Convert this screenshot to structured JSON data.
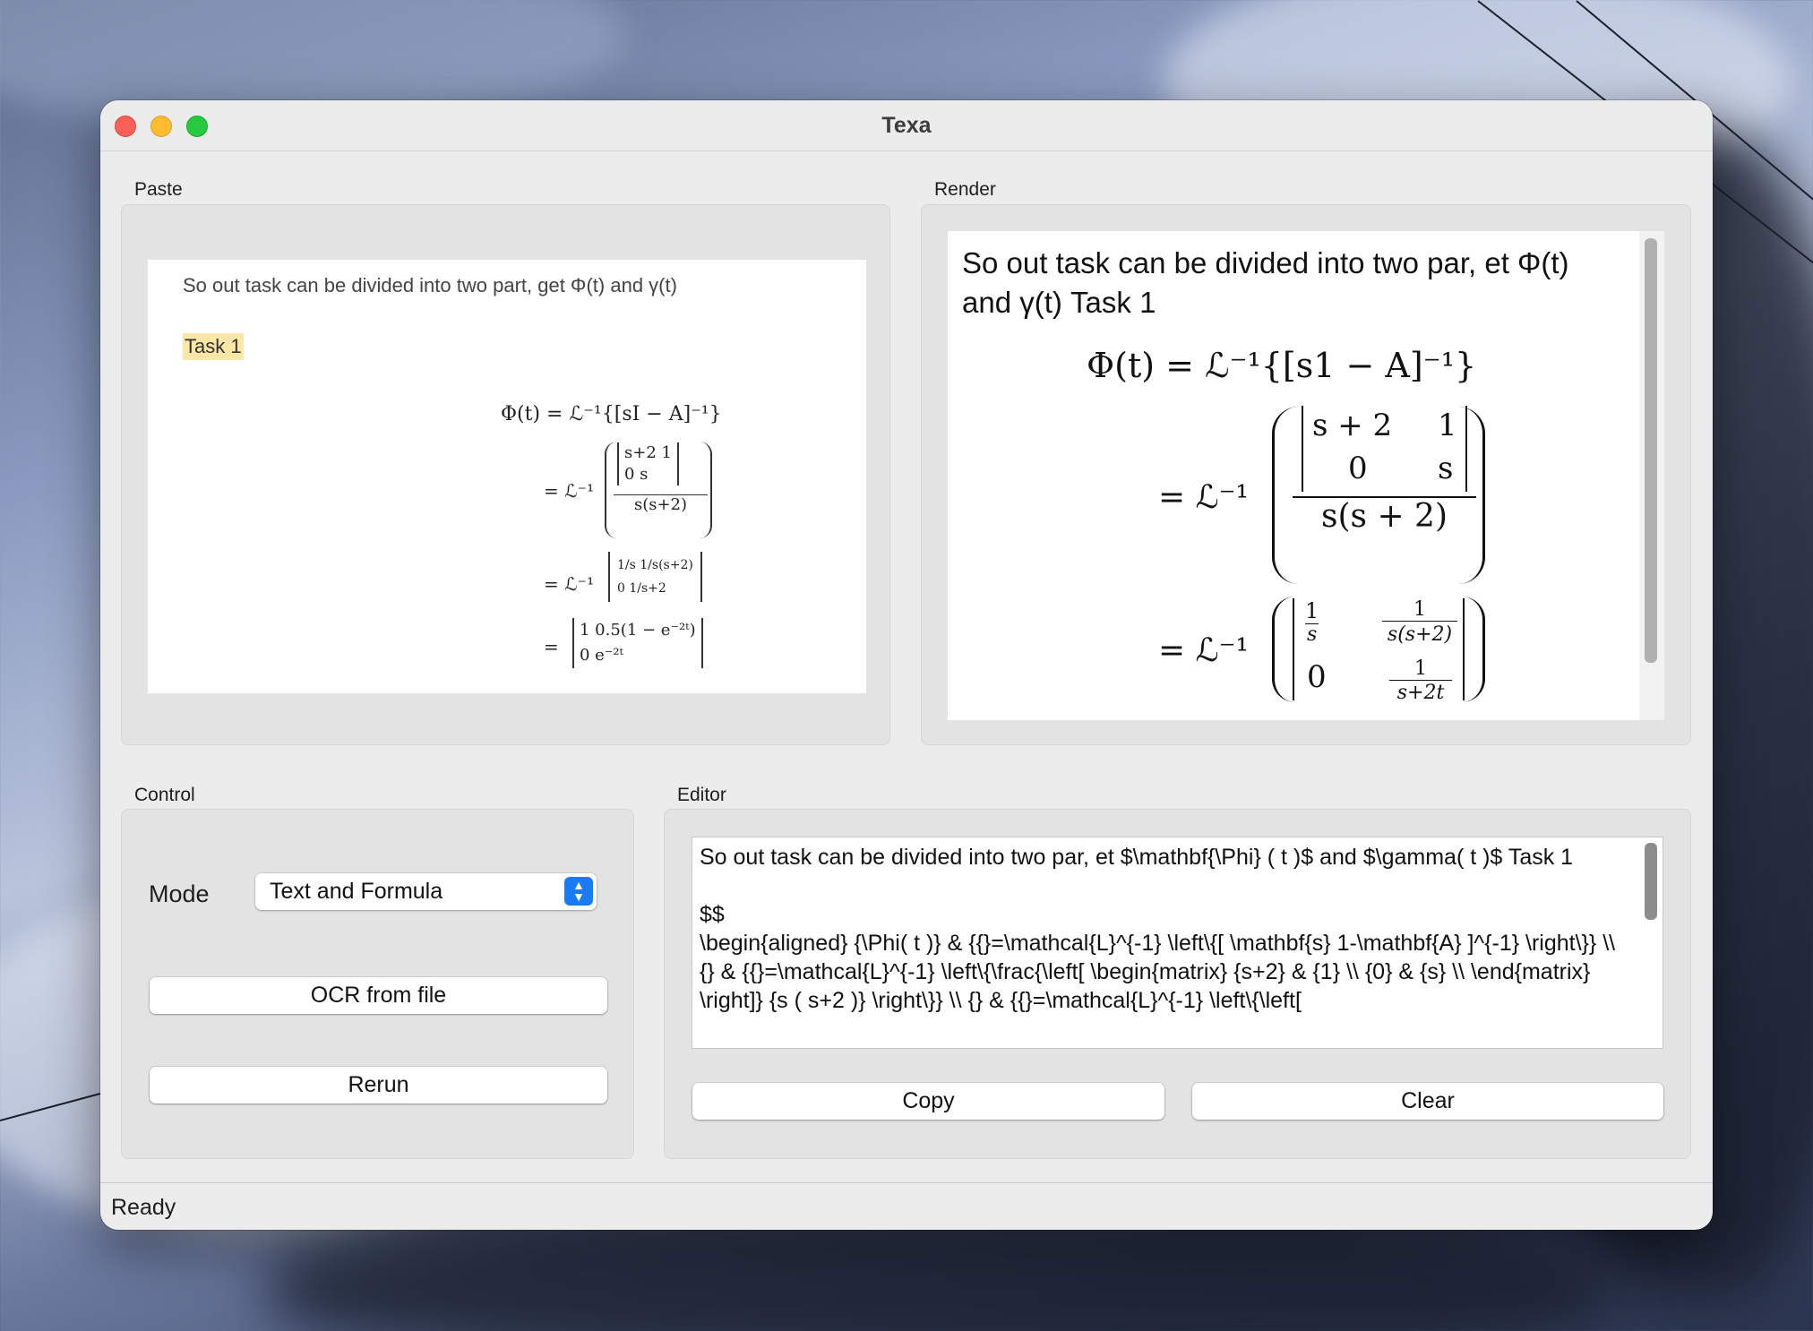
{
  "window": {
    "title": "Texa"
  },
  "paste": {
    "label": "Paste",
    "line1": "So out task can be divided into two part, get Φ(t) and γ(t)",
    "task": "Task 1",
    "eq1": "Φ(t) = ℒ⁻¹{[sI − A]⁻¹}",
    "eq2": "= ℒ⁻¹",
    "m11": "s+2   1",
    "m21": "0      s",
    "den": "s(s+2)",
    "eq3": "= ℒ⁻¹",
    "r3a": "1/s     1/s(s+2)",
    "r3b": "0       1/s+2",
    "eq4": "=",
    "r4a": "1   0.5(1 − e⁻²ᵗ)",
    "r4b": "0        e⁻²ᵗ"
  },
  "render": {
    "label": "Render",
    "text": "So out task can be divided into two par, et Φ(t) and γ(t) Task 1",
    "eq1": "Φ(t) = ℒ⁻¹{[s1 − A]⁻¹}",
    "eq2": "= ℒ⁻¹",
    "m11": "s + 2",
    "m12": "1",
    "m21": "0",
    "m22": "s",
    "den": "s(s + 2)",
    "eq3": "= ℒ⁻¹",
    "r3a": "1",
    "r3a_den": "s",
    "r3b": "1",
    "r3b_den": "s(s+2)",
    "r3c": "0",
    "r3d": "1",
    "r3d_den": "s+2t"
  },
  "control": {
    "label": "Control",
    "mode_label": "Mode",
    "mode_value": "Text and Formula",
    "ocr_button": "OCR from file",
    "rerun_button": "Rerun"
  },
  "editor": {
    "label": "Editor",
    "content": "So out task can be divided into two par, et $\\mathbf{\\Phi} ( t )$ and $\\gamma( t )$ Task 1\n\n$$\n\\begin{aligned} {\\Phi( t )} & {{}=\\mathcal{L}^{-1} \\left\\{[ \\mathbf{s} 1-\\mathbf{A} ]^{-1} \\right\\}} \\\\ {} & {{}=\\mathcal{L}^{-1} \\left\\{\\frac{\\left[ \\begin{matrix} {s+2} & {1} \\\\ {0} & {s} \\\\ \\end{matrix} \\right]} {s ( s+2 )} \\right\\}} \\\\ {} & {{}=\\mathcal{L}^{-1} \\left\\{\\left[",
    "copy_button": "Copy",
    "clear_button": "Clear"
  },
  "status": {
    "text": "Ready"
  }
}
